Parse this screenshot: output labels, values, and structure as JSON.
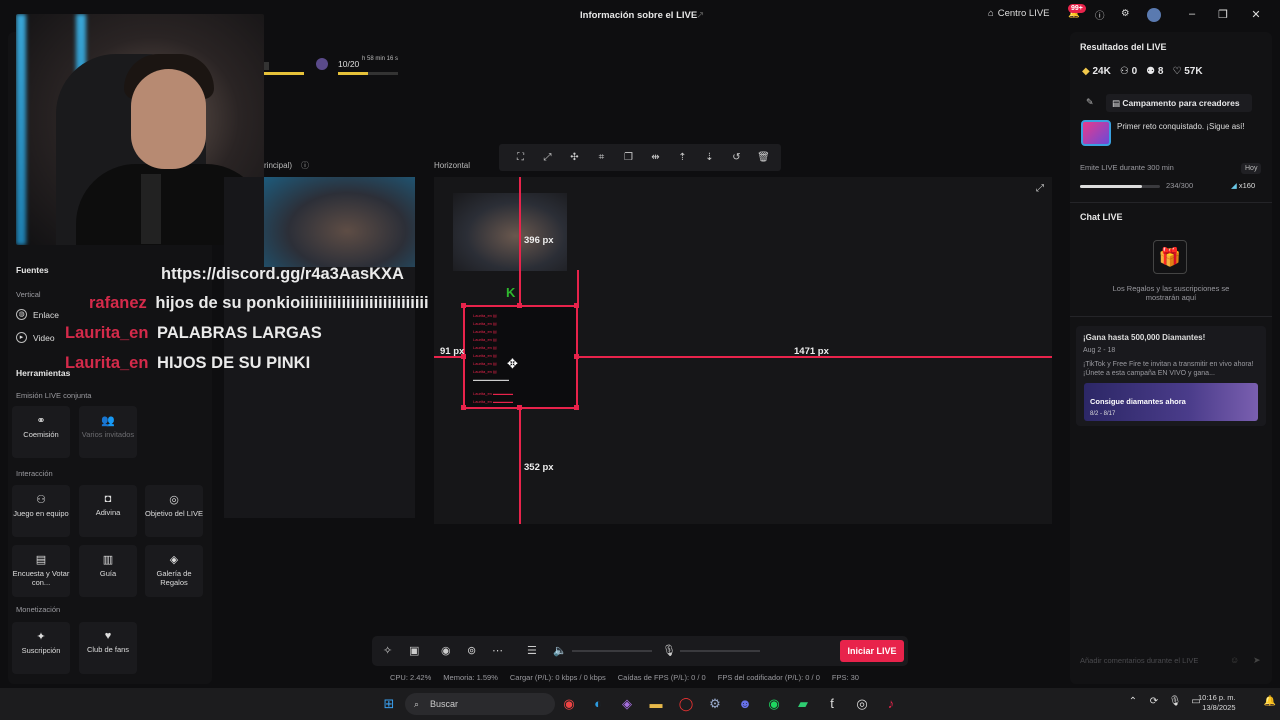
{
  "title_bar": {
    "title": "Información sobre el LIVE",
    "centro_live": "Centro LIVE",
    "notif_badge": "99+"
  },
  "top_widgets": {
    "timer": "h 58 min 16 s",
    "gift_progress": "10/20"
  },
  "left_panel": {
    "sources_title": "Fuentes",
    "vertical_label": "Vertical",
    "sources": [
      "Enlace",
      "Video"
    ],
    "tools_title": "Herramientas",
    "joint_live_label": "Emisión LIVE conjunta",
    "joint_tiles": [
      {
        "label": "Coemisión",
        "icon": "link-icon",
        "dim": false
      },
      {
        "label": "Varios invitados",
        "icon": "users-icon",
        "dim": true
      }
    ],
    "interaction_label": "Interacción",
    "interaction_tiles": [
      {
        "label": "Juego en equipo",
        "icon": "gamepad-icon"
      },
      {
        "label": "Adivina",
        "icon": "guess-icon"
      },
      {
        "label": "Objetivo del LIVE",
        "icon": "target-icon"
      },
      {
        "label": "Encuesta y Votar con...",
        "icon": "poll-icon"
      },
      {
        "label": "Guía",
        "icon": "guide-icon"
      },
      {
        "label": "Galería de Regalos",
        "icon": "gallery-icon"
      }
    ],
    "monetization_label": "Monetización",
    "monetization_tiles": [
      {
        "label": "Suscripción",
        "icon": "star-icon"
      },
      {
        "label": "Club de fans",
        "icon": "heart-icon"
      }
    ]
  },
  "center": {
    "principal_label": "rincipal)",
    "horizontal_label": "Horizontal",
    "measure_top": "396 px",
    "measure_left": "91 px",
    "measure_right": "1471 px",
    "measure_bottom": "352 px"
  },
  "chat_overlay": [
    {
      "user": "",
      "msg": "https://discord.gg/r4a3AasKXA"
    },
    {
      "user": "rafanez",
      "msg": "hijos de su ponkioiiiiiiiiiiiiiiiiiiiiiiiiiiii"
    },
    {
      "user": "Laurita_en",
      "msg": "PALABRAS LARGAS"
    },
    {
      "user": "Laurita_en",
      "msg": "HIJOS DE SU PINKI"
    }
  ],
  "bottom_bar": {
    "go_live": "Iniciar LIVE",
    "stats": [
      "CPU: 2.42%",
      "Memoria: 1.59%",
      "Cargar (P/L): 0 kbps / 0 kbps",
      "Caídas de FPS (P/L): 0 / 0",
      "FPS del codificador (P/L): 0 / 0",
      "FPS: 30"
    ]
  },
  "right_panel": {
    "results_title": "Resultados del LIVE",
    "stats": [
      {
        "icon": "diamond-icon",
        "value": "24K"
      },
      {
        "icon": "users-icon",
        "value": "0"
      },
      {
        "icon": "people-icon",
        "value": "8"
      },
      {
        "icon": "heart-icon",
        "value": "57K"
      }
    ],
    "camp_button": "Campamento para creadores",
    "challenge_text": "Primer reto conquistado. ¡Sigue así!",
    "emit_text": "Emite LIVE durante 300 min",
    "hoy": "Hoy",
    "progress_text": "234/300",
    "progress_fraction": 0.78,
    "reward": "x160",
    "chat_title": "Chat LIVE",
    "chat_empty": "Los Regalos y las suscripciones se mostrarán aquí",
    "promo_title": "¡Gana hasta 500,000 Diamantes!",
    "promo_dates": "Aug 2 - 18",
    "promo_text": "¡TikTok y Free Fire te invitan a transmitir en vivo ahora! ¡Únete a esta campaña EN VIVO y gana...",
    "promo_banner_text": "Consigue diamantes ahora",
    "promo_banner_dates": "8/2 - 8/17",
    "comment_placeholder": "Añadir comentarios durante el LIVE"
  },
  "taskbar": {
    "search": "Buscar",
    "time": "10:16 p. m.",
    "date": "13/8/2025"
  }
}
